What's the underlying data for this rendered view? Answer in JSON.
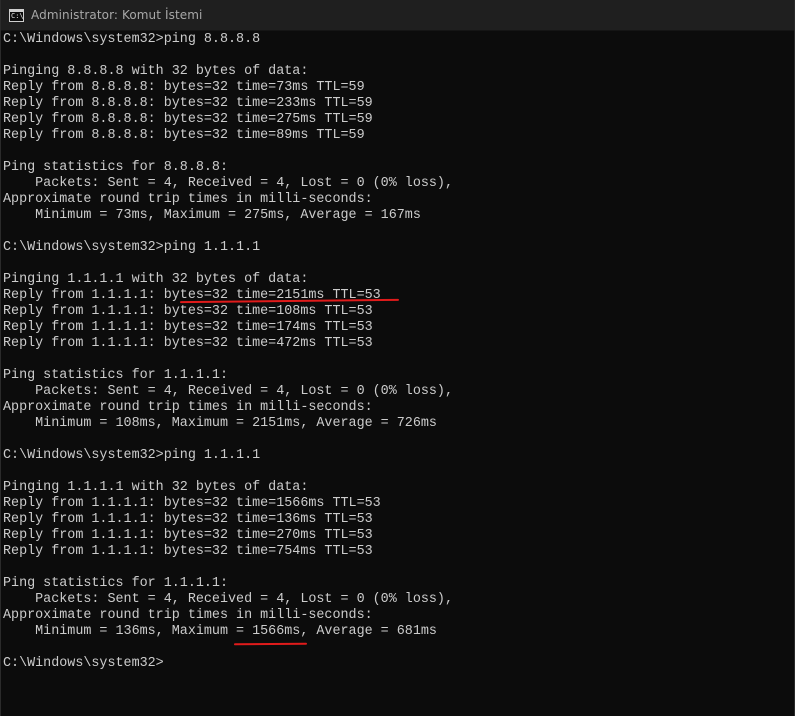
{
  "window": {
    "title": "Administrator: Komut İstemi",
    "icon": "cmd-icon",
    "icon_glyph": "C:\\"
  },
  "console": {
    "lines": [
      "C:\\Windows\\system32>ping 8.8.8.8",
      "",
      "Pinging 8.8.8.8 with 32 bytes of data:",
      "Reply from 8.8.8.8: bytes=32 time=73ms TTL=59",
      "Reply from 8.8.8.8: bytes=32 time=233ms TTL=59",
      "Reply from 8.8.8.8: bytes=32 time=275ms TTL=59",
      "Reply from 8.8.8.8: bytes=32 time=89ms TTL=59",
      "",
      "Ping statistics for 8.8.8.8:",
      "    Packets: Sent = 4, Received = 4, Lost = 0 (0% loss),",
      "Approximate round trip times in milli-seconds:",
      "    Minimum = 73ms, Maximum = 275ms, Average = 167ms",
      "",
      "C:\\Windows\\system32>ping 1.1.1.1",
      "",
      "Pinging 1.1.1.1 with 32 bytes of data:",
      "Reply from 1.1.1.1: bytes=32 time=2151ms TTL=53",
      "Reply from 1.1.1.1: bytes=32 time=108ms TTL=53",
      "Reply from 1.1.1.1: bytes=32 time=174ms TTL=53",
      "Reply from 1.1.1.1: bytes=32 time=472ms TTL=53",
      "",
      "Ping statistics for 1.1.1.1:",
      "    Packets: Sent = 4, Received = 4, Lost = 0 (0% loss),",
      "Approximate round trip times in milli-seconds:",
      "    Minimum = 108ms, Maximum = 2151ms, Average = 726ms",
      "",
      "C:\\Windows\\system32>ping 1.1.1.1",
      "",
      "Pinging 1.1.1.1 with 32 bytes of data:",
      "Reply from 1.1.1.1: bytes=32 time=1566ms TTL=53",
      "Reply from 1.1.1.1: bytes=32 time=136ms TTL=53",
      "Reply from 1.1.1.1: bytes=32 time=270ms TTL=53",
      "Reply from 1.1.1.1: bytes=32 time=754ms TTL=53",
      "",
      "Ping statistics for 1.1.1.1:",
      "    Packets: Sent = 4, Received = 4, Lost = 0 (0% loss),",
      "Approximate round trip times in milli-seconds:",
      "    Minimum = 136ms, Maximum = 1566ms, Average = 681ms",
      "",
      "C:\\Windows\\system32>"
    ]
  },
  "annotations": {
    "color": "#e01b1b"
  }
}
